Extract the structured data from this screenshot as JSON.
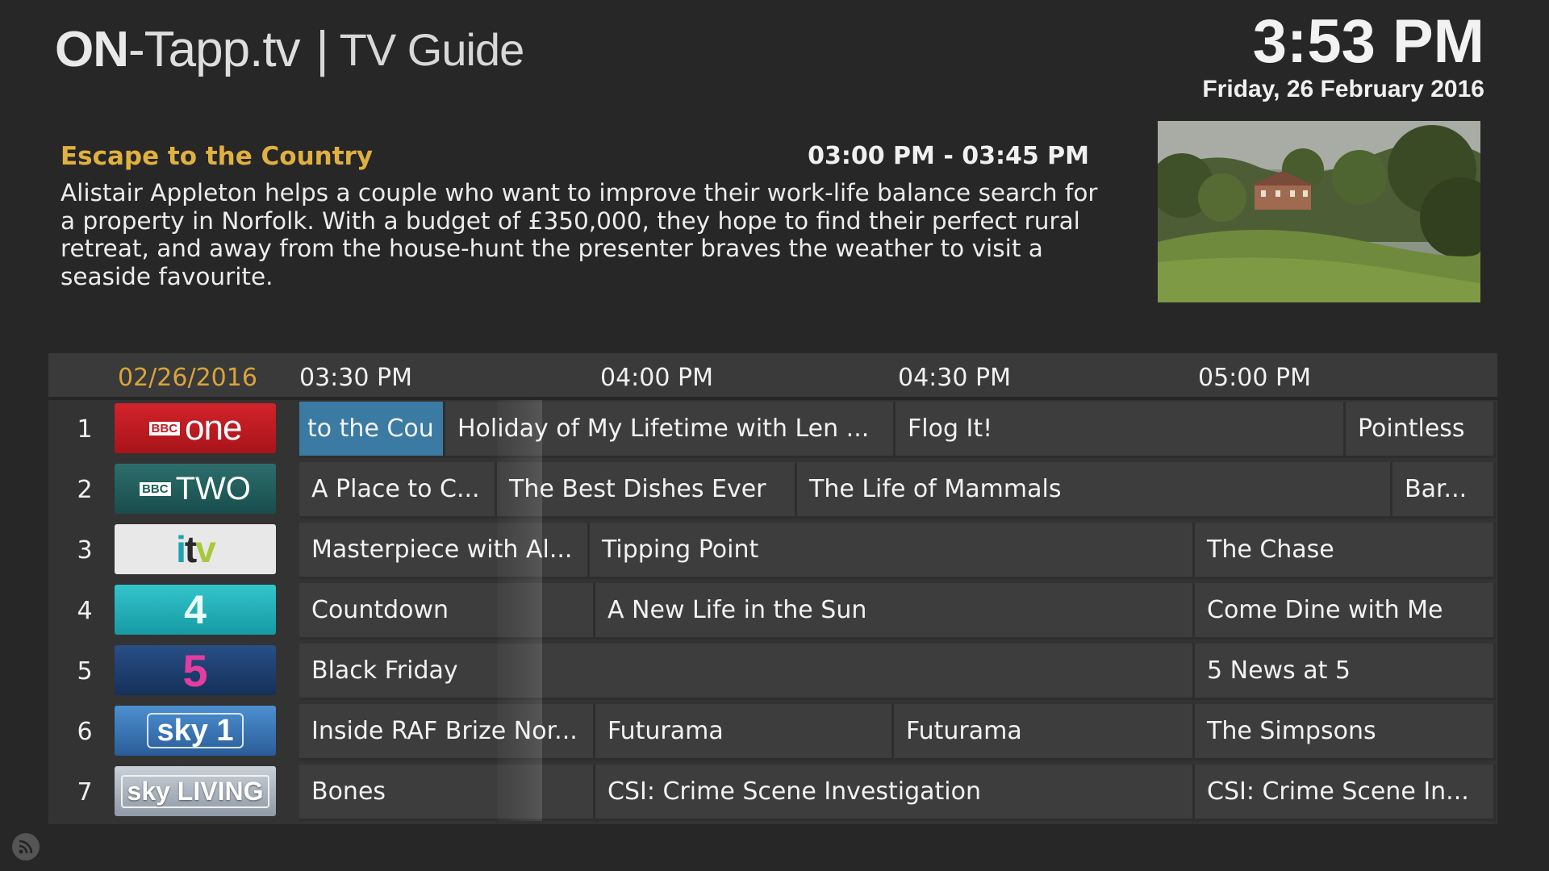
{
  "header": {
    "brand_on": "ON",
    "brand_rest": "-Tapp.tv",
    "separator": "|",
    "section": "TV Guide",
    "clock_time": "3:53 PM",
    "clock_date": "Friday, 26 February 2016"
  },
  "selected_program": {
    "title": "Escape to the Country",
    "time_range": "03:00 PM - 03:45 PM",
    "description": "Alistair Appleton helps a couple who want to improve their work-life balance search for a property in Norfolk. With a budget of £350,000, they hope to find their perfect rural retreat, and away from the house-hunt the presenter braves the weather to visit a seaside favourite."
  },
  "guide": {
    "date": "02/26/2016",
    "time_slots": [
      "03:30 PM",
      "04:00 PM",
      "04:30 PM",
      "05:00 PM"
    ],
    "channels": [
      {
        "number": "1",
        "logo": "BBC one",
        "programs": [
          "to the Cou",
          "Holiday of My Lifetime with Len ...",
          "Flog It!",
          "Pointless"
        ]
      },
      {
        "number": "2",
        "logo": "BBC TWO",
        "programs": [
          "A Place to C...",
          "The Best Dishes Ever",
          "The Life of Mammals",
          "Bar..."
        ]
      },
      {
        "number": "3",
        "logo": "itv",
        "programs": [
          "Masterpiece with Al...",
          "Tipping Point",
          "The Chase"
        ]
      },
      {
        "number": "4",
        "logo": "4",
        "programs": [
          "Countdown",
          "A New Life in the Sun",
          "Come Dine with Me"
        ]
      },
      {
        "number": "5",
        "logo": "5",
        "programs": [
          "Black Friday",
          "5 News at 5"
        ]
      },
      {
        "number": "6",
        "logo": "sky 1",
        "programs": [
          "Inside RAF Brize Nor...",
          "Futurama",
          "Futurama",
          "The Simpsons"
        ]
      },
      {
        "number": "7",
        "logo": "sky LIVING",
        "programs": [
          "Bones",
          "CSI: Crime Scene Investigation",
          "CSI: Crime Scene In..."
        ]
      }
    ]
  },
  "icons": {
    "status": "rss-icon"
  },
  "colors": {
    "accent": "#e0b040",
    "selected_cell": "#3a7aa3",
    "background": "#272727"
  }
}
